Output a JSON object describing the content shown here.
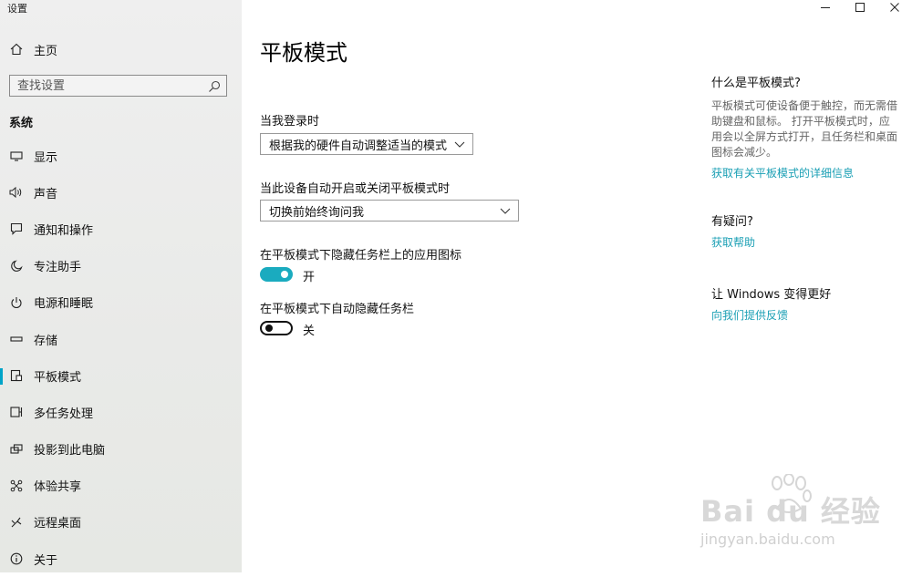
{
  "window": {
    "title": "设置"
  },
  "sidebar": {
    "home_label": "主页",
    "search_placeholder": "查找设置",
    "section": "系统",
    "items": [
      {
        "label": "显示",
        "icon": "monitor-icon"
      },
      {
        "label": "声音",
        "icon": "speaker-icon"
      },
      {
        "label": "通知和操作",
        "icon": "notification-icon"
      },
      {
        "label": "专注助手",
        "icon": "moon-icon"
      },
      {
        "label": "电源和睡眠",
        "icon": "power-icon"
      },
      {
        "label": "存储",
        "icon": "storage-icon"
      },
      {
        "label": "平板模式",
        "icon": "tablet-icon",
        "active": true
      },
      {
        "label": "多任务处理",
        "icon": "multitask-icon"
      },
      {
        "label": "投影到此电脑",
        "icon": "projector-icon"
      },
      {
        "label": "体验共享",
        "icon": "share-icon"
      },
      {
        "label": "远程桌面",
        "icon": "remote-desktop-icon"
      },
      {
        "label": "关于",
        "icon": "info-icon"
      }
    ]
  },
  "main": {
    "title": "平板模式",
    "signin_label": "当我登录时",
    "signin_value": "根据我的硬件自动调整适当的模式",
    "switch_label": "当此设备自动开启或关闭平板模式时",
    "switch_value": "切换前始终询问我",
    "hide_icons_label": "在平板模式下隐藏任务栏上的应用图标",
    "hide_icons_state": "开",
    "hide_icons_on": true,
    "auto_hide_label": "在平板模式下自动隐藏任务栏",
    "auto_hide_state": "关",
    "auto_hide_on": false
  },
  "right": {
    "what_title": "什么是平板模式?",
    "what_desc": "平板模式可使设备便于触控，而无需借助键盘和鼠标。 打开平板模式时，应用会以全屏方式打开，且任务栏和桌面图标会减少。",
    "what_link": "获取有关平板模式的详细信息",
    "help_title": "有疑问?",
    "help_link": "获取帮助",
    "feedback_title": "让 Windows 变得更好",
    "feedback_link": "向我们提供反馈"
  },
  "watermark": {
    "logo": "Bai du 经验",
    "url": "jingyan.baidu.com"
  },
  "colors": {
    "accent": "#1aabbf",
    "link": "#1a9fb4",
    "sidebar_bg": "#ebebea"
  }
}
